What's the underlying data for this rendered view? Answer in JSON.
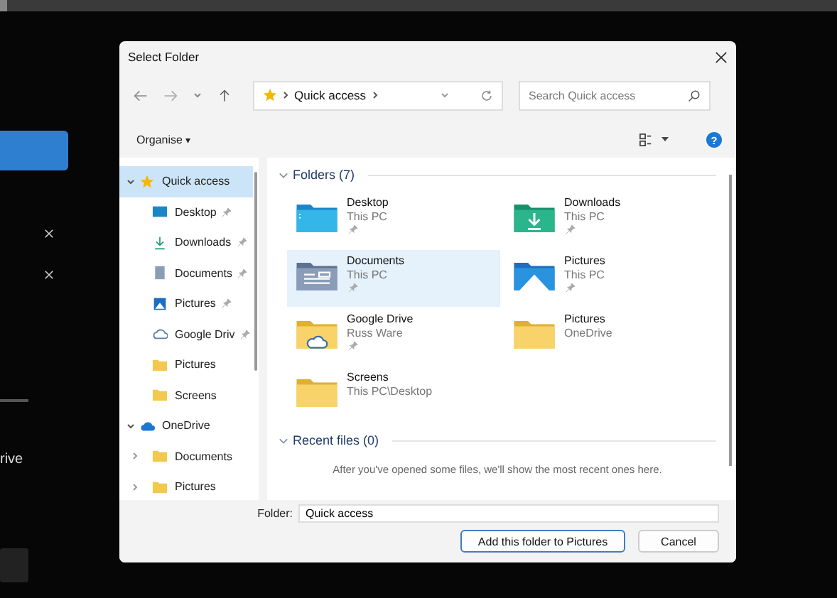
{
  "background": {
    "side_text": "rive"
  },
  "window": {
    "title": "Select Folder"
  },
  "address": {
    "location": "Quick access"
  },
  "search": {
    "placeholder": "Search Quick access"
  },
  "toolbar": {
    "organise": "Organise",
    "organise_caret": "▾",
    "help": "?"
  },
  "sidebar": {
    "items": [
      {
        "label": "Quick access",
        "kind": "star",
        "selected": true,
        "expanded": true,
        "children": [
          {
            "label": "Desktop",
            "kind": "desktop",
            "pinned": true
          },
          {
            "label": "Downloads",
            "kind": "downloads",
            "pinned": true
          },
          {
            "label": "Documents",
            "kind": "documents",
            "pinned": true
          },
          {
            "label": "Pictures",
            "kind": "pictures",
            "pinned": true
          },
          {
            "label": "Google Driv",
            "kind": "cloud",
            "pinned": true
          },
          {
            "label": "Pictures",
            "kind": "folder",
            "pinned": false
          },
          {
            "label": "Screens",
            "kind": "folder",
            "pinned": false
          }
        ]
      },
      {
        "label": "OneDrive",
        "kind": "onedrive",
        "selected": false,
        "expanded": true,
        "children": [
          {
            "label": "Documents",
            "kind": "folder",
            "pinned": false,
            "expanded": false
          },
          {
            "label": "Pictures",
            "kind": "folder",
            "pinned": false,
            "expanded": false
          }
        ]
      }
    ]
  },
  "folders": {
    "heading": "Folders (7)",
    "expanded": true,
    "items": [
      {
        "name": "Desktop",
        "location": "This PC",
        "kind": "desktop",
        "pinned": true,
        "selected": false
      },
      {
        "name": "Downloads",
        "location": "This PC",
        "kind": "downloads",
        "pinned": true,
        "selected": false
      },
      {
        "name": "Documents",
        "location": "This PC",
        "kind": "documents",
        "pinned": true,
        "selected": true
      },
      {
        "name": "Pictures",
        "location": "This PC",
        "kind": "pictures",
        "pinned": true,
        "selected": false
      },
      {
        "name": "Google Drive",
        "location": "Russ Ware",
        "kind": "cloud",
        "pinned": true,
        "selected": false
      },
      {
        "name": "Pictures",
        "location": "OneDrive",
        "kind": "folder",
        "pinned": false,
        "selected": false
      },
      {
        "name": "Screens",
        "location": "This PC\\Desktop",
        "kind": "folder",
        "pinned": false,
        "selected": false
      }
    ]
  },
  "recent": {
    "heading": "Recent files (0)",
    "expanded": true,
    "message": "After you've opened some files, we'll show the most recent ones here."
  },
  "folder_field": {
    "label": "Folder:",
    "value": "Quick access"
  },
  "buttons": [
    {
      "label": "Add this folder to Pictures",
      "primary": true
    },
    {
      "label": "Cancel",
      "primary": false
    }
  ]
}
